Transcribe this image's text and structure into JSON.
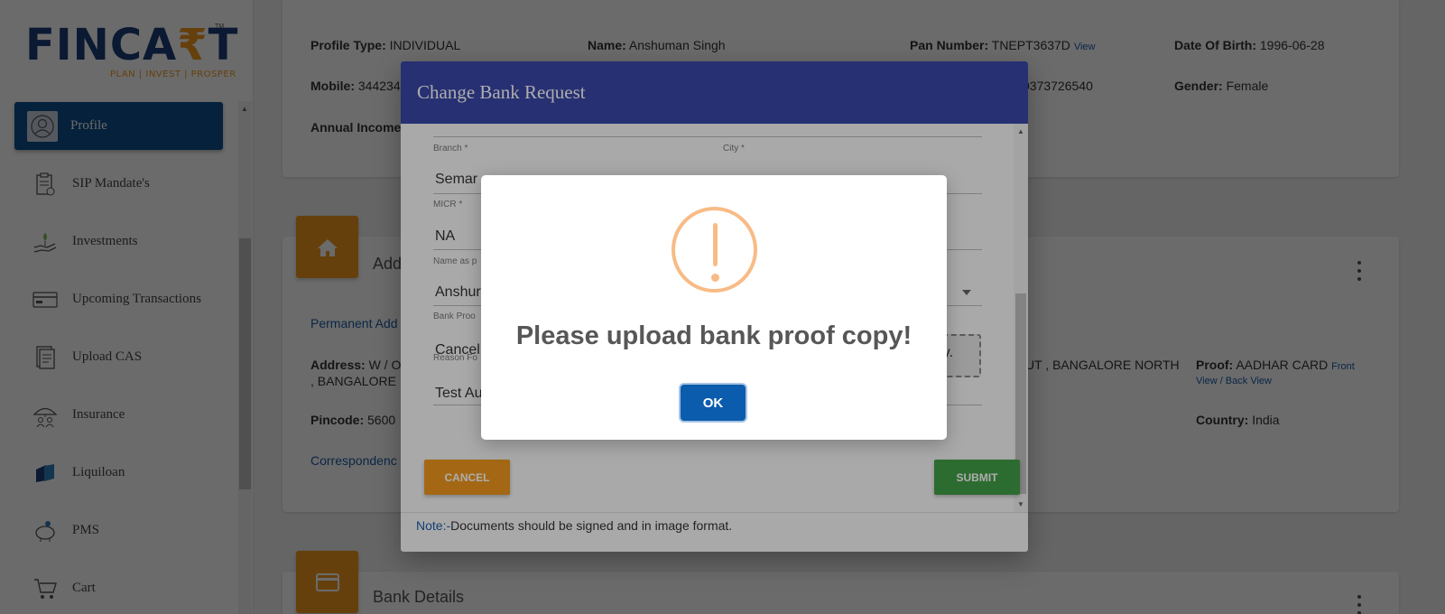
{
  "logo": {
    "word_part1": "FINCA",
    "word_accent": "₹",
    "word_part2": "T",
    "tagline": "PLAN | INVEST | PROSPER",
    "tm": "TM"
  },
  "sidebar": {
    "items": [
      {
        "label": "Profile",
        "icon": "user-icon",
        "active": true
      },
      {
        "label": "SIP Mandate's",
        "icon": "clipboard-icon"
      },
      {
        "label": "Investments",
        "icon": "money-hand-icon"
      },
      {
        "label": "Upcoming Transactions",
        "icon": "card-icon"
      },
      {
        "label": "Upload CAS",
        "icon": "document-icon"
      },
      {
        "label": "Insurance",
        "icon": "umbrella-family-icon"
      },
      {
        "label": "Liquiloan",
        "icon": "liquiloan-icon"
      },
      {
        "label": "PMS",
        "icon": "piggy-bank-icon"
      },
      {
        "label": "Cart",
        "icon": "cart-icon"
      }
    ]
  },
  "profile": {
    "profile_type_label": "Profile Type:",
    "profile_type": "INDIVIDUAL",
    "name_label": "Name:",
    "name": "Anshuman Singh",
    "pan_label": "Pan Number:",
    "pan": "TNEPT3637D",
    "pan_view": "View",
    "dob_label": "Date Of Birth:",
    "dob": "1996-06-28",
    "mobile_label": "Mobile:",
    "mobile": "344234",
    "middle_value": "0373726540",
    "gender_label": "Gender:",
    "gender": "Female",
    "annual_income_label": "Annual Income"
  },
  "address": {
    "section_title": "Add",
    "permanent_link": "Permanent Add",
    "address_label": "Address:",
    "address_line1": "W / O",
    "address_line2": ", BANGALORE ,",
    "address_right": "UT , BANGALORE NORTH",
    "proof_label": "Proof:",
    "proof_value": "AADHAR CARD",
    "proof_front": "Front",
    "proof_back": "View / Back View",
    "pincode_label": "Pincode:",
    "pincode": "5600",
    "country_label": "Country:",
    "country": "India",
    "correspondence_link": "Correspondenc"
  },
  "bank_details": {
    "title": "Bank Details"
  },
  "modal": {
    "title": "Change Bank Request",
    "fields": {
      "branch_label": "Branch *",
      "branch_value": "Semar",
      "city_label": "City *",
      "micr_label": "MICR *",
      "micr_value": "NA",
      "name_label": "Name as p",
      "name_value": "Anshur",
      "bank_proof_label": "Bank Proo",
      "bank_proof_value": "Cancel",
      "upload_text": "opy.",
      "reason_label": "Reason Fo",
      "reason_value": "Test Au"
    },
    "cancel_label": "CANCEL",
    "submit_label": "SUBMIT",
    "note_prefix": "Note:-",
    "note_text": "Documents should be signed and in image format."
  },
  "alert": {
    "icon": "warning-icon",
    "title": "Please upload bank proof copy!",
    "ok_label": "OK"
  },
  "colors": {
    "primary": "#0e4f8f",
    "accent": "#f29a1f",
    "modal_header": "#3a47a8",
    "submit": "#43a047",
    "warning": "#f8bb86"
  }
}
